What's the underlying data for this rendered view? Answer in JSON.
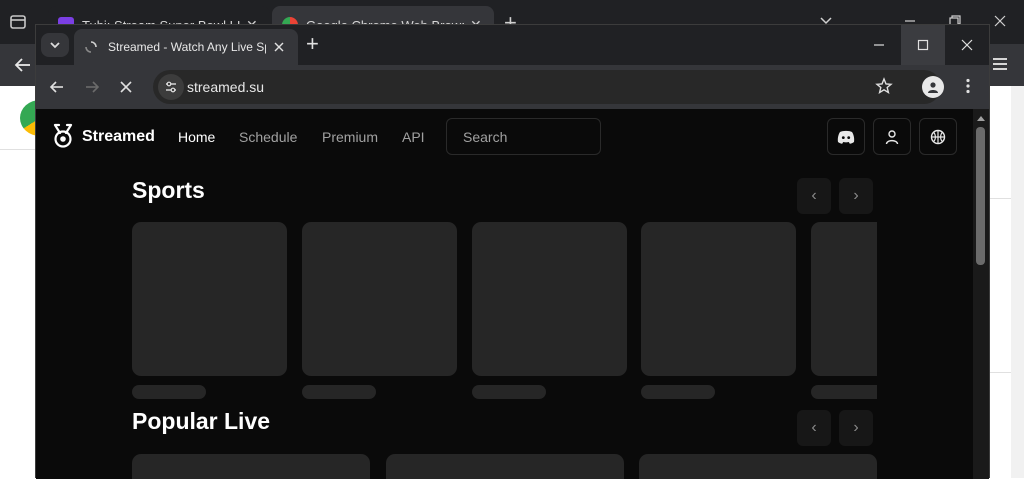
{
  "background_window": {
    "tabs": [
      {
        "title": "Tubi: Stream Super Bowl LIX for",
        "favicon": "tubi-icon",
        "favicon_color": "#7b3fe4"
      },
      {
        "title": "Google Chrome Web Browser | Ch",
        "favicon": "chrome-icon",
        "favicon_color": "#4285f4"
      }
    ]
  },
  "browser": {
    "tab": {
      "title": "Streamed - Watch Any Live Sports",
      "favicon": "loading-icon"
    },
    "url": "streamed.su"
  },
  "site": {
    "brand": "Streamed",
    "nav": [
      {
        "label": "Home",
        "active": true
      },
      {
        "label": "Schedule",
        "active": false
      },
      {
        "label": "Premium",
        "active": false
      },
      {
        "label": "API",
        "active": false
      }
    ],
    "search": {
      "placeholder": "Search"
    },
    "icons": [
      "discord-icon",
      "user-icon",
      "basketball-icon"
    ],
    "sections": [
      {
        "title": "Sports",
        "prev": "‹",
        "next": "›"
      },
      {
        "title": "Popular Live",
        "prev": "‹",
        "next": "›"
      }
    ]
  },
  "colors": {
    "page_bg": "#0a0a0a",
    "skeleton": "#262626",
    "chrome_dark": "#202124",
    "chrome_toolbar": "#35363a"
  }
}
